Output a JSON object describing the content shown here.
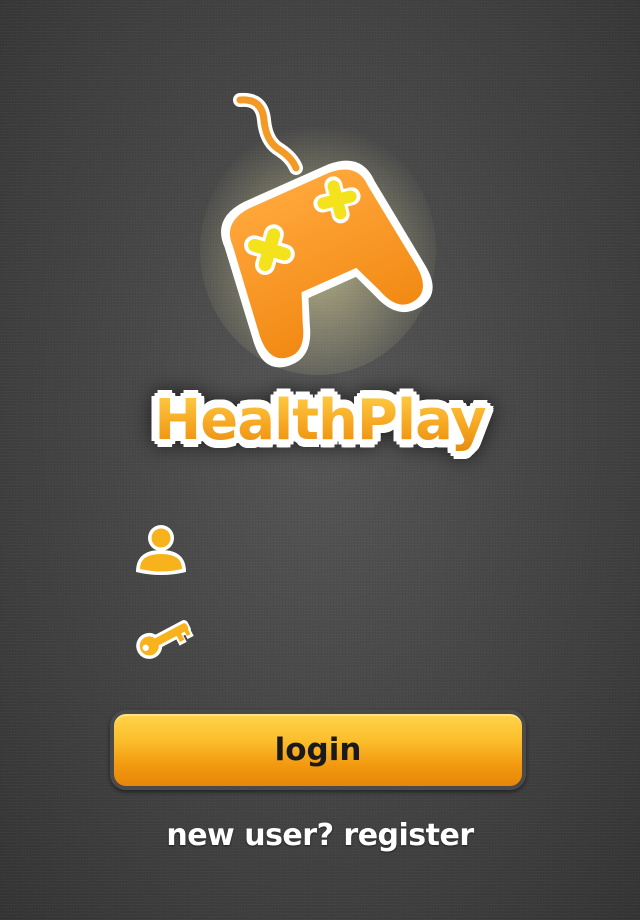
{
  "app": {
    "title": "HealthPlay",
    "logo_icon": "gamepad-icon"
  },
  "login_form": {
    "username": {
      "icon": "user-icon",
      "value": "",
      "placeholder": ""
    },
    "password": {
      "icon": "key-icon",
      "value": "",
      "placeholder": ""
    },
    "login_label": "login",
    "register_label": "new user? register"
  },
  "colors": {
    "accent_orange": "#f7a823",
    "accent_yellow": "#ffd54a",
    "background": "#474747",
    "text_light": "#ffffff"
  }
}
